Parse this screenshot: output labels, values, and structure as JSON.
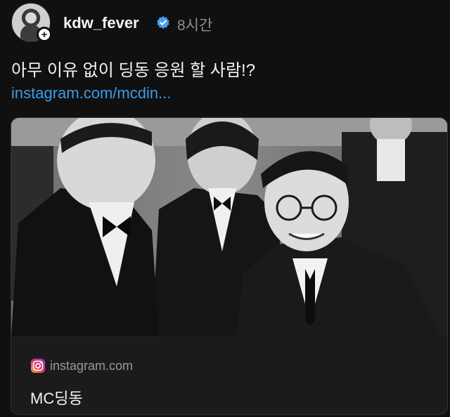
{
  "post": {
    "author": {
      "username": "kdw_fever",
      "verified": true,
      "avatar_icon": "avatar-photo",
      "follow_badge": "+"
    },
    "time": "8시간",
    "text": "아무 이유 없이 딩동 응원 할 사람!?",
    "link": "instagram.com/mcdin..."
  },
  "link_card": {
    "image_description_icon": "photo-of-four-men-in-tuxedos",
    "domain_icon": "instagram-icon",
    "domain": "instagram.com",
    "title": "MC딩동"
  },
  "colors": {
    "background": "#101010",
    "link": "#3a9ce8",
    "verified_badge": "#4a9df0",
    "muted": "#8f8f8f"
  }
}
